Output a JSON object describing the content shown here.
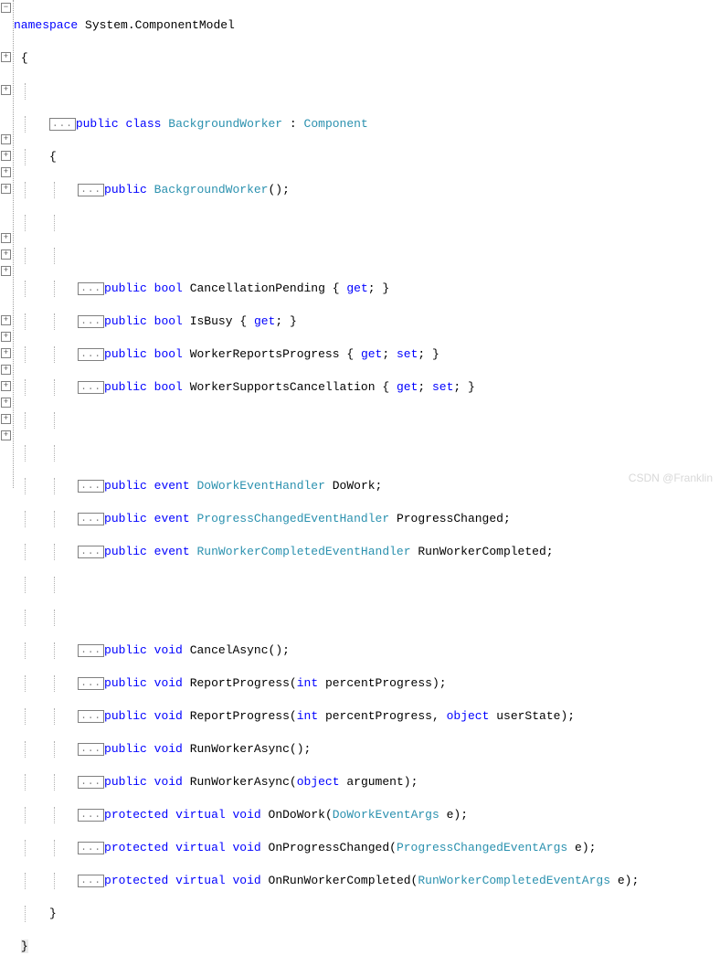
{
  "fold_label": "...",
  "minus_label": "−",
  "plus_label": "+",
  "punc": {
    "openBrace": "{",
    "closeBrace": "}",
    "semi": ";",
    "colon": ":",
    "openParen": "(",
    "closeParen": ")",
    "comma": ","
  },
  "kw": {
    "namespace": "namespace",
    "public": "public",
    "class": "class",
    "bool": "bool",
    "get": "get",
    "set": "set",
    "event": "event",
    "void": "void",
    "int": "int",
    "object": "object",
    "protected": "protected",
    "virtual": "virtual"
  },
  "ns": "System.ComponentModel",
  "className": "BackgroundWorker",
  "baseClass": "Component",
  "ctor": "BackgroundWorker",
  "props": {
    "p1": "CancellationPending",
    "p2": "IsBusy",
    "p3": "WorkerReportsProgress",
    "p4": "WorkerSupportsCancellation"
  },
  "events": {
    "h1": "DoWorkEventHandler",
    "n1": "DoWork",
    "h2": "ProgressChangedEventHandler",
    "n2": "ProgressChanged",
    "h3": "RunWorkerCompletedEventHandler",
    "n3": "RunWorkerCompleted"
  },
  "methods": {
    "m1": "CancelAsync",
    "m2": "ReportProgress",
    "m2p1": "percentProgress",
    "m3": "ReportProgress",
    "m3p1": "percentProgress",
    "m3p2": "userState",
    "m4": "RunWorkerAsync",
    "m5": "RunWorkerAsync",
    "m5p1": "argument",
    "m6": "OnDoWork",
    "m6t": "DoWorkEventArgs",
    "m6p": "e",
    "m7": "OnProgressChanged",
    "m7t": "ProgressChangedEventArgs",
    "m7p": "e",
    "m8": "OnRunWorkerCompleted",
    "m8t": "RunWorkerCompletedEventArgs",
    "m8p": "e"
  },
  "watermark": "CSDN @Franklin"
}
